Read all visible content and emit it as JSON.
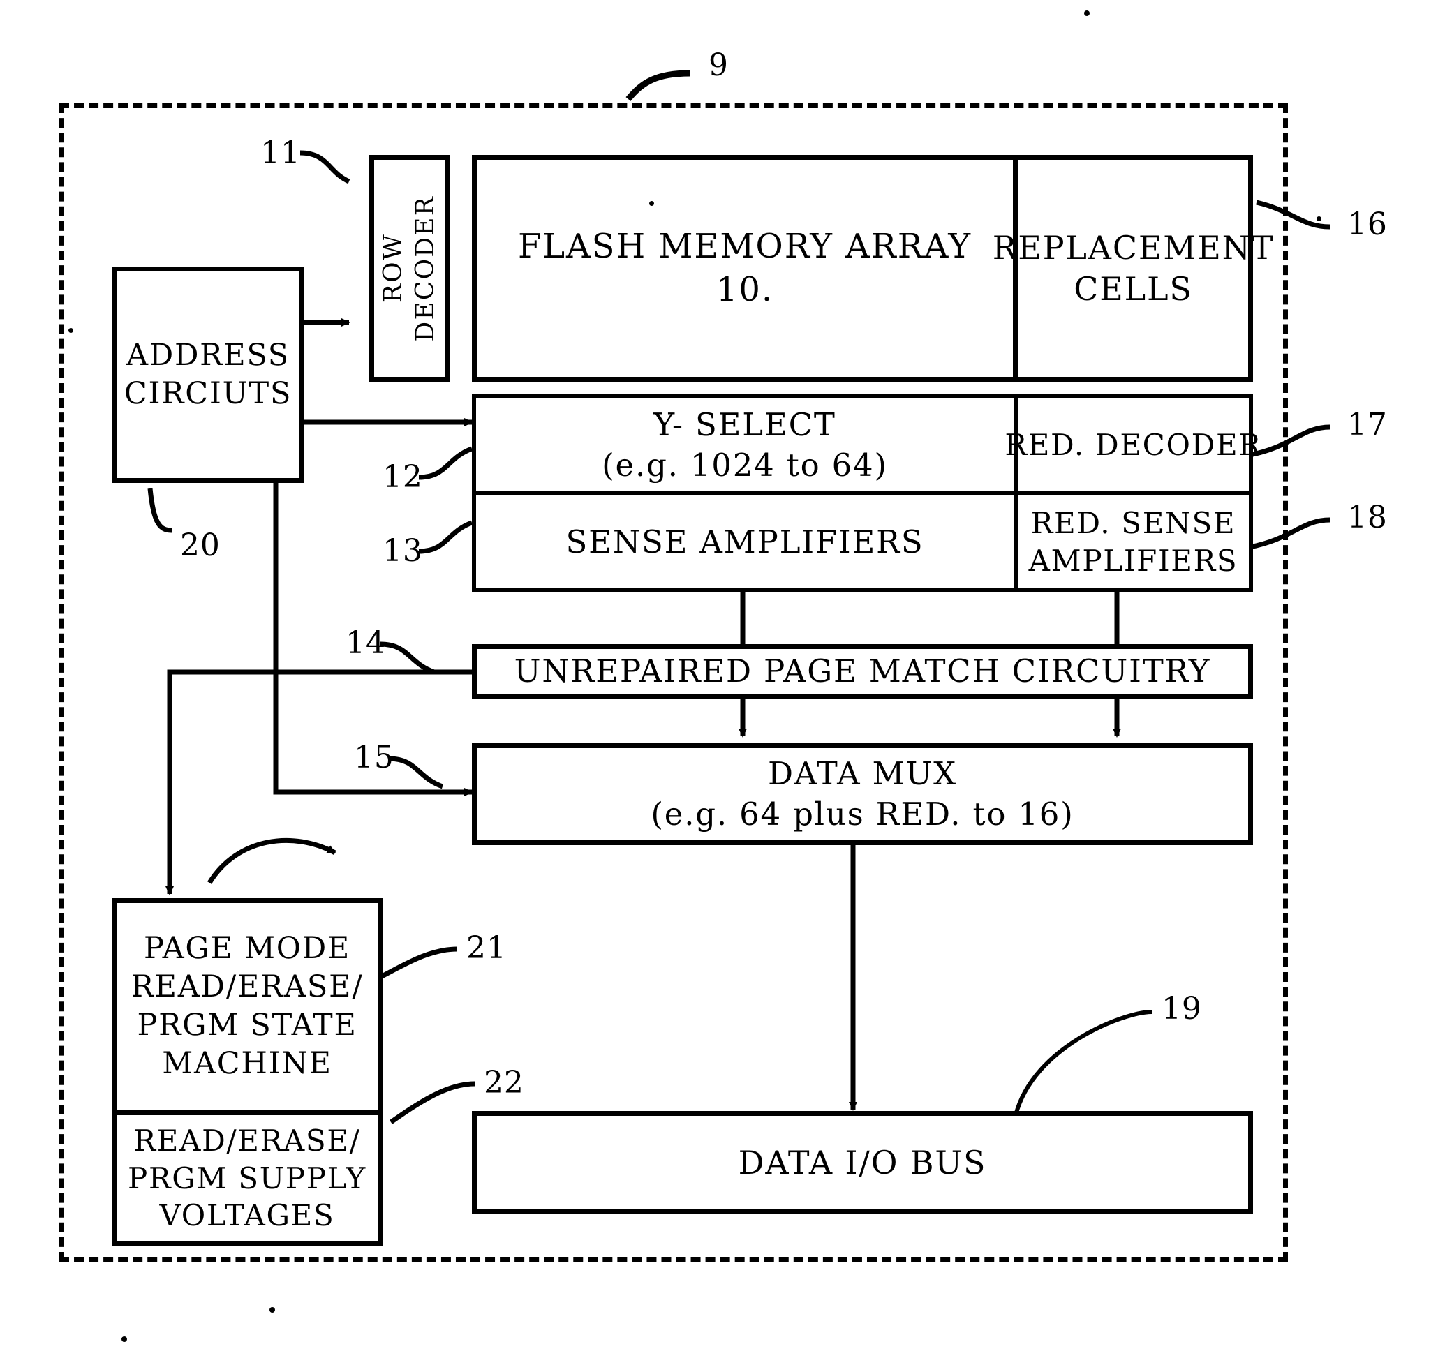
{
  "figure": {
    "title": "Flash memory array with redundancy repair block diagram",
    "line_color": "#000000",
    "background": "#ffffff"
  },
  "chip": {
    "ref": "9"
  },
  "blocks": {
    "address_circuits": {
      "ref": "20",
      "lines": [
        "ADDRESS",
        "CIRCIUTS"
      ]
    },
    "row_decoder": {
      "ref": "11",
      "lines": [
        "ROW",
        "DECODER"
      ]
    },
    "flash_memory_array": {
      "ref": "10",
      "lines": [
        "FLASH MEMORY ARRAY",
        "10."
      ]
    },
    "replacement_cells": {
      "ref": "16",
      "lines": [
        "REPLACEMENT",
        "CELLS"
      ]
    },
    "y_select": {
      "ref": "12",
      "lines": [
        "Y- SELECT",
        "(e.g. 1024 to 64)"
      ]
    },
    "red_decoder": {
      "ref": "17",
      "lines": [
        "RED. DECODER"
      ]
    },
    "sense_amplifiers": {
      "ref": "13",
      "lines": [
        "SENSE AMPLIFIERS"
      ]
    },
    "red_sense_amplifiers": {
      "ref": "18",
      "lines": [
        "RED. SENSE",
        "AMPLIFIERS"
      ]
    },
    "unrepaired_page_match": {
      "ref": "14",
      "lines": [
        "UNREPAIRED PAGE MATCH CIRCUITRY"
      ]
    },
    "data_mux": {
      "ref": "15",
      "lines": [
        "DATA MUX",
        "(e.g. 64 plus RED. to 16)"
      ]
    },
    "state_machine": {
      "ref": "21",
      "lines": [
        "PAGE MODE",
        "READ/ERASE/",
        "PRGM STATE",
        "MACHINE"
      ]
    },
    "supply_voltages": {
      "ref": "22",
      "lines": [
        "READ/ERASE/",
        "PRGM SUPPLY",
        "VOLTAGES"
      ]
    },
    "data_io_bus": {
      "ref": "19",
      "lines": [
        "DATA I/O BUS"
      ]
    }
  }
}
